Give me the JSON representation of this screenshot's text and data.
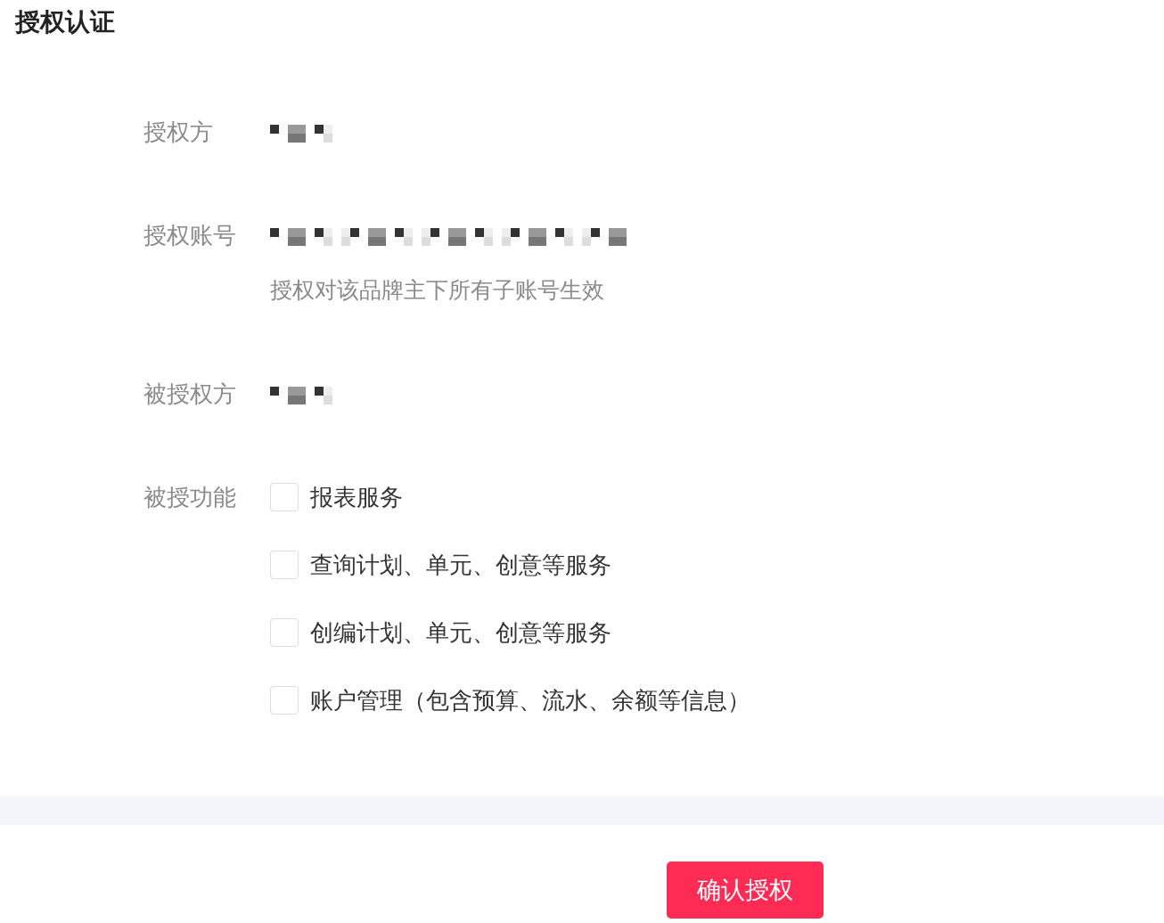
{
  "title": "授权认证",
  "fields": [
    {
      "label": "授权方",
      "value": {
        "kind": "redacted"
      }
    },
    {
      "label": "授权账号",
      "value": {
        "kind": "redactedlong"
      },
      "hint": "授权对该品牌主下所有子账号生效"
    },
    {
      "label": "被授权方",
      "value": {
        "kind": "redacted"
      }
    }
  ],
  "features": {
    "label": "被授功能",
    "options": [
      {
        "label": "报表服务",
        "checked": false
      },
      {
        "label": "查询计划、单元、创意等服务",
        "checked": false
      },
      {
        "label": "创编计划、单元、创意等服务",
        "checked": false
      },
      {
        "label": "账户管理（包含预算、流水、余额等信息）",
        "checked": false
      }
    ]
  },
  "confirm_button": "确认授权"
}
